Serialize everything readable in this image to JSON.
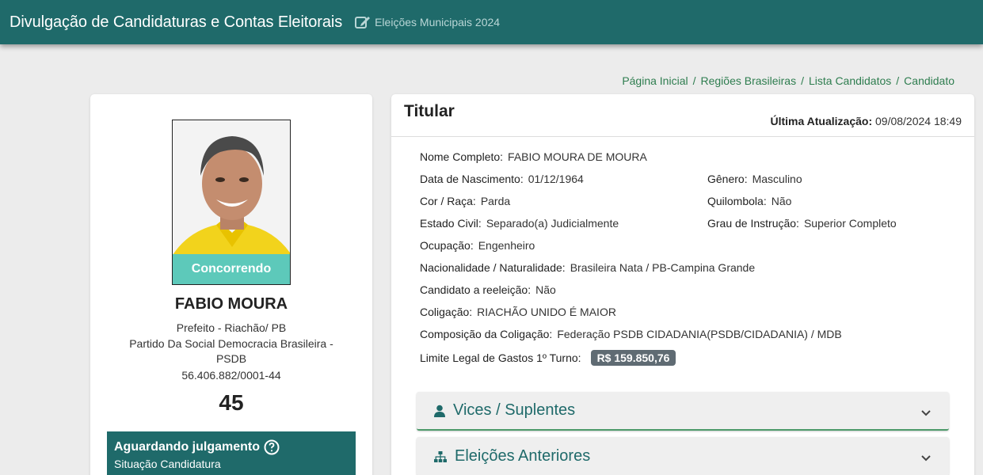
{
  "header": {
    "title": "Divulgação de Candidaturas e Contas Eleitorais",
    "subtitle": "Eleições Municipais 2024",
    "subtitle_icon": "edit-icon"
  },
  "breadcrumb": [
    "Página Inicial",
    "Regiões Brasileiras",
    "Lista Candidatos",
    "Candidato"
  ],
  "candidate": {
    "photo_status": "Concorrendo",
    "name": "FABIO MOURA",
    "office": "Prefeito - Riachão/ PB",
    "party_line1": "Partido Da Social Democracia Brasileira -",
    "party_line2": "PSDB",
    "cnpj": "56.406.882/0001-44",
    "number": "45",
    "status_title": "Aguardando julgamento",
    "status_subtitle": "Situação Candidatura"
  },
  "details": {
    "section_title": "Titular",
    "updated_label": "Última Atualização:",
    "updated_value": "09/08/2024 18:49",
    "fields": {
      "nome_completo": {
        "label": "Nome Completo:",
        "value": "FABIO MOURA DE MOURA"
      },
      "data_nascimento": {
        "label": "Data de Nascimento:",
        "value": "01/12/1964"
      },
      "genero": {
        "label": "Gênero:",
        "value": "Masculino"
      },
      "cor_raca": {
        "label": "Cor / Raça:",
        "value": "Parda"
      },
      "quilombola": {
        "label": "Quilombola:",
        "value": "Não"
      },
      "estado_civil": {
        "label": "Estado Civil:",
        "value": "Separado(a) Judicialmente"
      },
      "grau_instrucao": {
        "label": "Grau de Instrução:",
        "value": "Superior Completo"
      },
      "ocupacao": {
        "label": "Ocupação:",
        "value": "Engenheiro"
      },
      "nacionalidade": {
        "label": "Nacionalidade / Naturalidade:",
        "value": "Brasileira Nata / PB-Campina Grande"
      },
      "reeleicao": {
        "label": "Candidato a reeleição:",
        "value": "Não"
      },
      "coligacao": {
        "label": "Coligação:",
        "value": "RIACHÃO UNIDO É MAIOR"
      },
      "composicao": {
        "label": "Composição da Coligação:",
        "value": "Federação PSDB CIDADANIA(PSDB/CIDADANIA) / MDB"
      },
      "limite_gastos": {
        "label": "Limite Legal de Gastos 1º Turno:",
        "value": "R$ 159.850,76"
      }
    }
  },
  "accordions": [
    {
      "label": "Vices / Suplentes",
      "icon": "user-icon"
    },
    {
      "label": "Eleições Anteriores",
      "icon": "sitemap-icon"
    }
  ],
  "colors": {
    "primary": "#1f6a6a",
    "link": "#2e7d4f",
    "badge": "#5f6b73",
    "photo_status": "#50c8c8"
  }
}
